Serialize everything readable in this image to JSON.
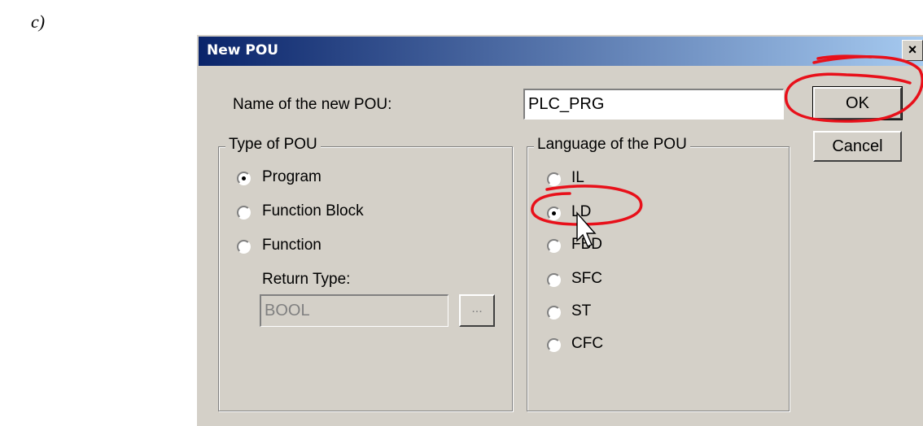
{
  "caption": "c)",
  "dialog": {
    "title": "New POU",
    "close_label": "×",
    "name_label": "Name of the new POU:",
    "name_value": "PLC_PRG",
    "ok_label": "OK",
    "cancel_label": "Cancel",
    "type_group": {
      "legend": "Type of POU",
      "options": [
        "Program",
        "Function Block",
        "Function"
      ],
      "selected": "Program",
      "return_type_label": "Return Type:",
      "return_type_value": "BOOL",
      "browse_label": "..."
    },
    "language_group": {
      "legend": "Language of the POU",
      "options": [
        "IL",
        "LD",
        "FBD",
        "SFC",
        "ST",
        "CFC"
      ],
      "selected": "LD"
    }
  },
  "colors": {
    "dialog_bg": "#d4d0c8",
    "title_start": "#0a246a",
    "title_end": "#a6caf0",
    "annotation": "#e8101a"
  },
  "icons": [
    "close-icon",
    "mouse-cursor-icon"
  ]
}
